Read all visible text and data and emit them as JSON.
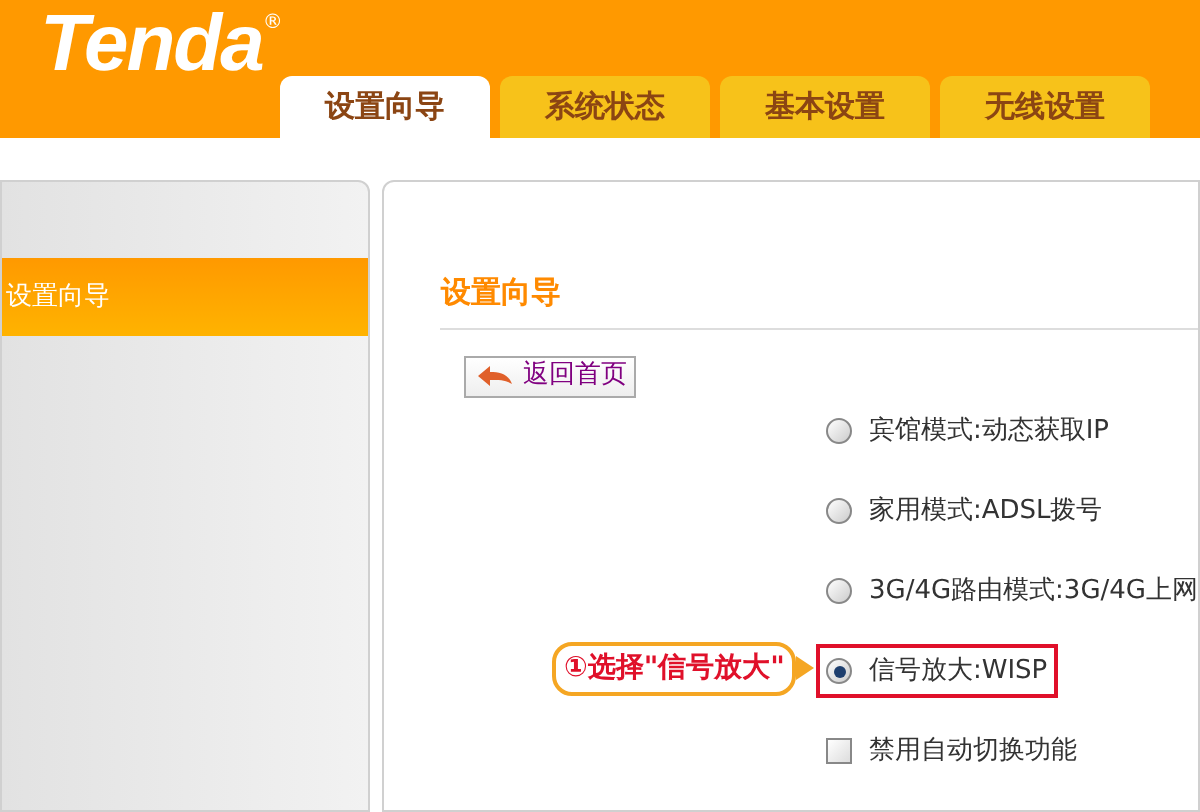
{
  "header": {
    "logo": "Tenda",
    "logo_mark": "®"
  },
  "tabs": [
    {
      "label": "设置向导",
      "selected": true
    },
    {
      "label": "系统状态",
      "selected": false
    },
    {
      "label": "基本设置",
      "selected": false
    },
    {
      "label": "无线设置",
      "selected": false
    }
  ],
  "sidebar": {
    "items": [
      {
        "label": "设置向导",
        "selected": true
      }
    ]
  },
  "content": {
    "title": "设置向导",
    "back_button": "返回首页",
    "options": [
      {
        "kind": "radio",
        "label": "宾馆模式:动态获取IP",
        "selected": false
      },
      {
        "kind": "radio",
        "label": "家用模式:ADSL拨号",
        "selected": false
      },
      {
        "kind": "radio",
        "label": "3G/4G路由模式:3G/4G上网",
        "selected": false
      },
      {
        "kind": "radio",
        "label": "信号放大:WISP",
        "selected": true,
        "highlighted": true
      },
      {
        "kind": "checkbox",
        "label": "禁用自动切换功能",
        "checked": false
      }
    ]
  },
  "annotation": {
    "text": "①选择\"信号放大\""
  }
}
